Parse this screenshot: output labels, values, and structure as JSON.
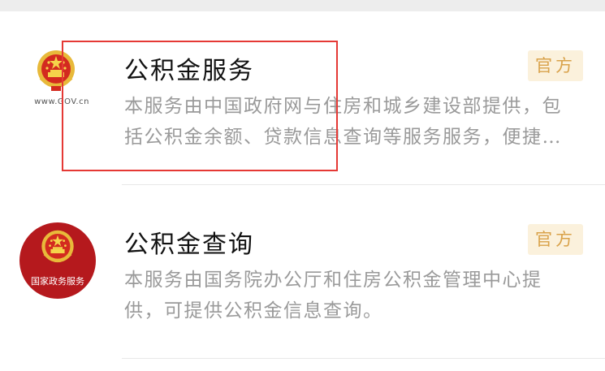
{
  "items": [
    {
      "title": "公积金服务",
      "description": "本服务由中国政府网与住房和城乡建设部提供，包括公积金余额、贷款信息查询等服务服务，便捷查询",
      "badge": "官方",
      "logo_text": "www.GOV.cn",
      "logo_icon": "national-emblem-icon"
    },
    {
      "title": "公积金查询",
      "description": "本服务由国务院办公厅和住房公积金管理中心提供，可提供公积金信息查询。",
      "badge": "官方",
      "logo_text": "国家政务服务",
      "logo_icon": "national-emblem-icon"
    }
  ],
  "colors": {
    "highlight": "#e53935",
    "badge_bg": "#fbf1dc",
    "badge_text": "#d9a24a",
    "logo_red": "#b5191d"
  }
}
